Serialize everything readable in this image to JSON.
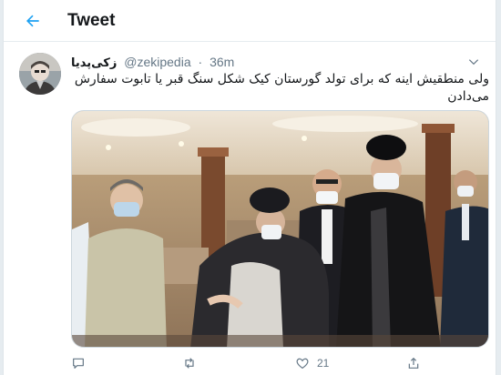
{
  "header": {
    "title": "Tweet",
    "back_icon": "arrow-left-icon"
  },
  "tweet": {
    "display_name": "زکی‌پدیا",
    "handle": "@zekipedia",
    "separator": "·",
    "time": "36m",
    "text_line1": "ولی منطقیش اینه که برای تولد گورستان کیک شکل سنگ قبر یا تابوت سفارش",
    "text_line2": "می‌دادن"
  },
  "actions": {
    "reply": {
      "icon": "reply-icon"
    },
    "retweet": {
      "icon": "retweet-icon"
    },
    "like": {
      "icon": "heart-icon",
      "count": "21"
    },
    "share": {
      "icon": "share-icon"
    }
  },
  "colors": {
    "accent": "#1da1f2",
    "text": "#14171a",
    "secondary": "#657786",
    "border": "#e6ecf0"
  }
}
